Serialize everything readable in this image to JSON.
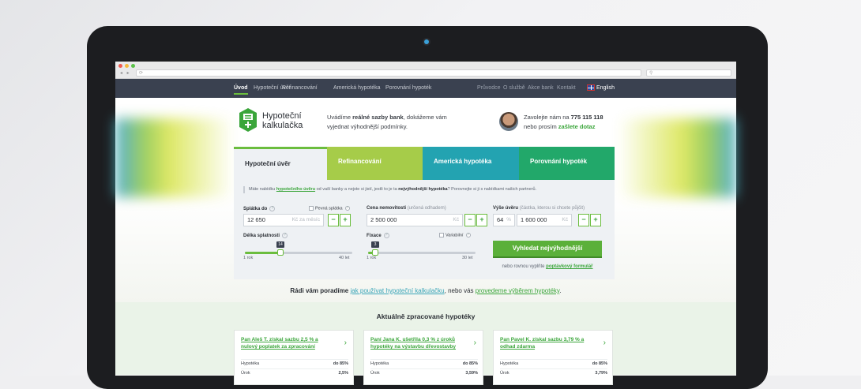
{
  "nav": {
    "left": [
      "Úvod",
      "Hypoteční úvěr",
      "Refinancování",
      "Americká hypotéka",
      "Porovnání hypoték"
    ],
    "right": [
      "Průvodce",
      "O službě",
      "Akce bank",
      "Kontakt"
    ],
    "lang": "English"
  },
  "header": {
    "logo_line1": "Hypoteční",
    "logo_line2": "kalkulačka",
    "intro_pre": "Uvádíme ",
    "intro_bold": "reálné sazby bank",
    "intro_post": ", dokážeme vám",
    "intro_line2": "vyjednat výhodnější podmínky.",
    "contact_pre": "Zavolejte nám na ",
    "contact_phone": "775 115 118",
    "contact_line2_pre": "nebo prosím ",
    "contact_link": "zašlete dotaz"
  },
  "tabs": [
    "Hypoteční úvěr",
    "Refinancování",
    "Americká hypotéka",
    "Porovnání hypoték"
  ],
  "form": {
    "note_pre": "Máte nabídku ",
    "note_link": "hypotečního úvěru",
    "note_mid": " od vaší banky a nejste si jistí, jestli to je ta ",
    "note_bold": "nejvýhodnější hypotéka",
    "note_post": "? Porovnejte si ji s nabídkami našich partnerů.",
    "splatka_label": "Splátka do",
    "fixed_label": "Pevná splátka",
    "splatka_value": "12 650",
    "splatka_suffix": "Kč za měsíc",
    "cena_label": "Cena nemovitosti",
    "cena_hint": "(určená odhadem)",
    "cena_value": "2 500 000",
    "cena_suffix": "Kč",
    "vyse_label": "Výše úvěru",
    "vyse_hint": "(částka, kterou si chcete půjčit)",
    "pct_value": "64",
    "pct_suffix": "%",
    "vyse_value": "1 600 000",
    "vyse_suffix": "Kč",
    "minus": "−",
    "plus": "+",
    "delka_label": "Délka splatnosti",
    "delka_value": "14",
    "delka_min": "1 rok",
    "delka_max": "40 let",
    "delka_fraction": 0.333,
    "fixace_label": "Fixace",
    "variable_label": "Variabilní",
    "fixace_value": "3",
    "fixace_min": "1 rok",
    "fixace_max": "30 let",
    "fixace_fraction": 0.069,
    "cta": "Vyhledat nejvýhodnější",
    "cta_alt_pre": "nebo rovnou vyplňte ",
    "cta_alt_link": "poptávkový formulář"
  },
  "advice": {
    "pre": "Rádi vám poradíme ",
    "link1": "jak používat hypoteční kalkulačku",
    "mid": ", nebo vás ",
    "link2": "provedeme výběrem hypotéky",
    "post": "."
  },
  "recent": {
    "title": "Aktuálně zpracované hypotéky",
    "cards": [
      {
        "title": "Pan Aleš T. získal sazbu 2,5 % a nulový poplatek za zpracování",
        "r1": "Hypotéka",
        "v1": "do 85%",
        "r2": "Úrok",
        "v2": "2,5%"
      },
      {
        "title": "Paní Jana K. ušetřila 0,3 % z úroků hypotéky na výstavbu dřevostavby",
        "r1": "Hypotéka",
        "v1": "do 85%",
        "r2": "Úrok",
        "v2": "3,59%"
      },
      {
        "title": "Pan Pavel K. získal sazbu 3,79 % a odhad zdarma",
        "r1": "Hypotéka",
        "v1": "do 85%",
        "r2": "Úrok",
        "v2": "3,79%"
      }
    ]
  },
  "colors": {
    "accent": "#6bbd3e",
    "tab_refi": "#a6cc49",
    "tab_us": "#23a3b1",
    "tab_cmp": "#22a86a",
    "nav_bg": "#3a4150"
  }
}
